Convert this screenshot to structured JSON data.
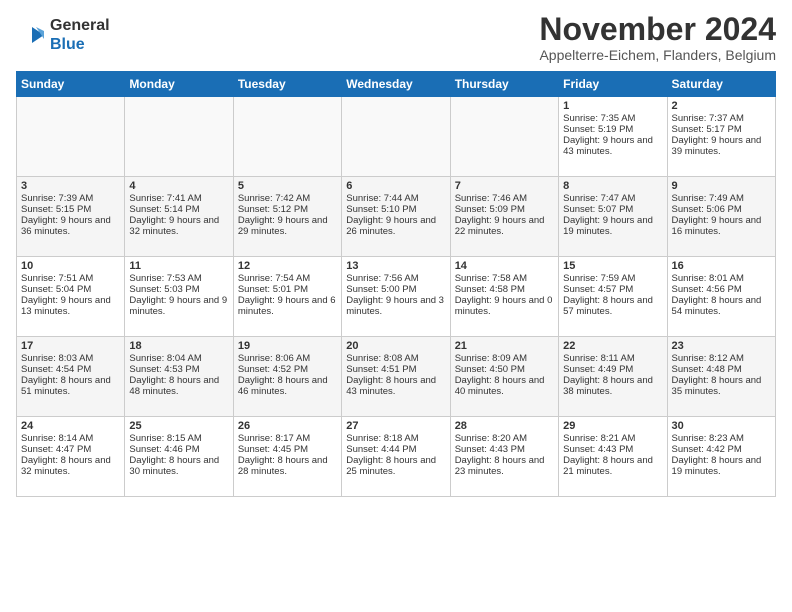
{
  "header": {
    "logo_line1": "General",
    "logo_line2": "Blue",
    "month": "November 2024",
    "location": "Appelterre-Eichem, Flanders, Belgium"
  },
  "weekdays": [
    "Sunday",
    "Monday",
    "Tuesday",
    "Wednesday",
    "Thursday",
    "Friday",
    "Saturday"
  ],
  "weeks": [
    [
      {
        "day": "",
        "info": ""
      },
      {
        "day": "",
        "info": ""
      },
      {
        "day": "",
        "info": ""
      },
      {
        "day": "",
        "info": ""
      },
      {
        "day": "",
        "info": ""
      },
      {
        "day": "1",
        "info": "Sunrise: 7:35 AM\nSunset: 5:19 PM\nDaylight: 9 hours and 43 minutes."
      },
      {
        "day": "2",
        "info": "Sunrise: 7:37 AM\nSunset: 5:17 PM\nDaylight: 9 hours and 39 minutes."
      }
    ],
    [
      {
        "day": "3",
        "info": "Sunrise: 7:39 AM\nSunset: 5:15 PM\nDaylight: 9 hours and 36 minutes."
      },
      {
        "day": "4",
        "info": "Sunrise: 7:41 AM\nSunset: 5:14 PM\nDaylight: 9 hours and 32 minutes."
      },
      {
        "day": "5",
        "info": "Sunrise: 7:42 AM\nSunset: 5:12 PM\nDaylight: 9 hours and 29 minutes."
      },
      {
        "day": "6",
        "info": "Sunrise: 7:44 AM\nSunset: 5:10 PM\nDaylight: 9 hours and 26 minutes."
      },
      {
        "day": "7",
        "info": "Sunrise: 7:46 AM\nSunset: 5:09 PM\nDaylight: 9 hours and 22 minutes."
      },
      {
        "day": "8",
        "info": "Sunrise: 7:47 AM\nSunset: 5:07 PM\nDaylight: 9 hours and 19 minutes."
      },
      {
        "day": "9",
        "info": "Sunrise: 7:49 AM\nSunset: 5:06 PM\nDaylight: 9 hours and 16 minutes."
      }
    ],
    [
      {
        "day": "10",
        "info": "Sunrise: 7:51 AM\nSunset: 5:04 PM\nDaylight: 9 hours and 13 minutes."
      },
      {
        "day": "11",
        "info": "Sunrise: 7:53 AM\nSunset: 5:03 PM\nDaylight: 9 hours and 9 minutes."
      },
      {
        "day": "12",
        "info": "Sunrise: 7:54 AM\nSunset: 5:01 PM\nDaylight: 9 hours and 6 minutes."
      },
      {
        "day": "13",
        "info": "Sunrise: 7:56 AM\nSunset: 5:00 PM\nDaylight: 9 hours and 3 minutes."
      },
      {
        "day": "14",
        "info": "Sunrise: 7:58 AM\nSunset: 4:58 PM\nDaylight: 9 hours and 0 minutes."
      },
      {
        "day": "15",
        "info": "Sunrise: 7:59 AM\nSunset: 4:57 PM\nDaylight: 8 hours and 57 minutes."
      },
      {
        "day": "16",
        "info": "Sunrise: 8:01 AM\nSunset: 4:56 PM\nDaylight: 8 hours and 54 minutes."
      }
    ],
    [
      {
        "day": "17",
        "info": "Sunrise: 8:03 AM\nSunset: 4:54 PM\nDaylight: 8 hours and 51 minutes."
      },
      {
        "day": "18",
        "info": "Sunrise: 8:04 AM\nSunset: 4:53 PM\nDaylight: 8 hours and 48 minutes."
      },
      {
        "day": "19",
        "info": "Sunrise: 8:06 AM\nSunset: 4:52 PM\nDaylight: 8 hours and 46 minutes."
      },
      {
        "day": "20",
        "info": "Sunrise: 8:08 AM\nSunset: 4:51 PM\nDaylight: 8 hours and 43 minutes."
      },
      {
        "day": "21",
        "info": "Sunrise: 8:09 AM\nSunset: 4:50 PM\nDaylight: 8 hours and 40 minutes."
      },
      {
        "day": "22",
        "info": "Sunrise: 8:11 AM\nSunset: 4:49 PM\nDaylight: 8 hours and 38 minutes."
      },
      {
        "day": "23",
        "info": "Sunrise: 8:12 AM\nSunset: 4:48 PM\nDaylight: 8 hours and 35 minutes."
      }
    ],
    [
      {
        "day": "24",
        "info": "Sunrise: 8:14 AM\nSunset: 4:47 PM\nDaylight: 8 hours and 32 minutes."
      },
      {
        "day": "25",
        "info": "Sunrise: 8:15 AM\nSunset: 4:46 PM\nDaylight: 8 hours and 30 minutes."
      },
      {
        "day": "26",
        "info": "Sunrise: 8:17 AM\nSunset: 4:45 PM\nDaylight: 8 hours and 28 minutes."
      },
      {
        "day": "27",
        "info": "Sunrise: 8:18 AM\nSunset: 4:44 PM\nDaylight: 8 hours and 25 minutes."
      },
      {
        "day": "28",
        "info": "Sunrise: 8:20 AM\nSunset: 4:43 PM\nDaylight: 8 hours and 23 minutes."
      },
      {
        "day": "29",
        "info": "Sunrise: 8:21 AM\nSunset: 4:43 PM\nDaylight: 8 hours and 21 minutes."
      },
      {
        "day": "30",
        "info": "Sunrise: 8:23 AM\nSunset: 4:42 PM\nDaylight: 8 hours and 19 minutes."
      }
    ]
  ]
}
